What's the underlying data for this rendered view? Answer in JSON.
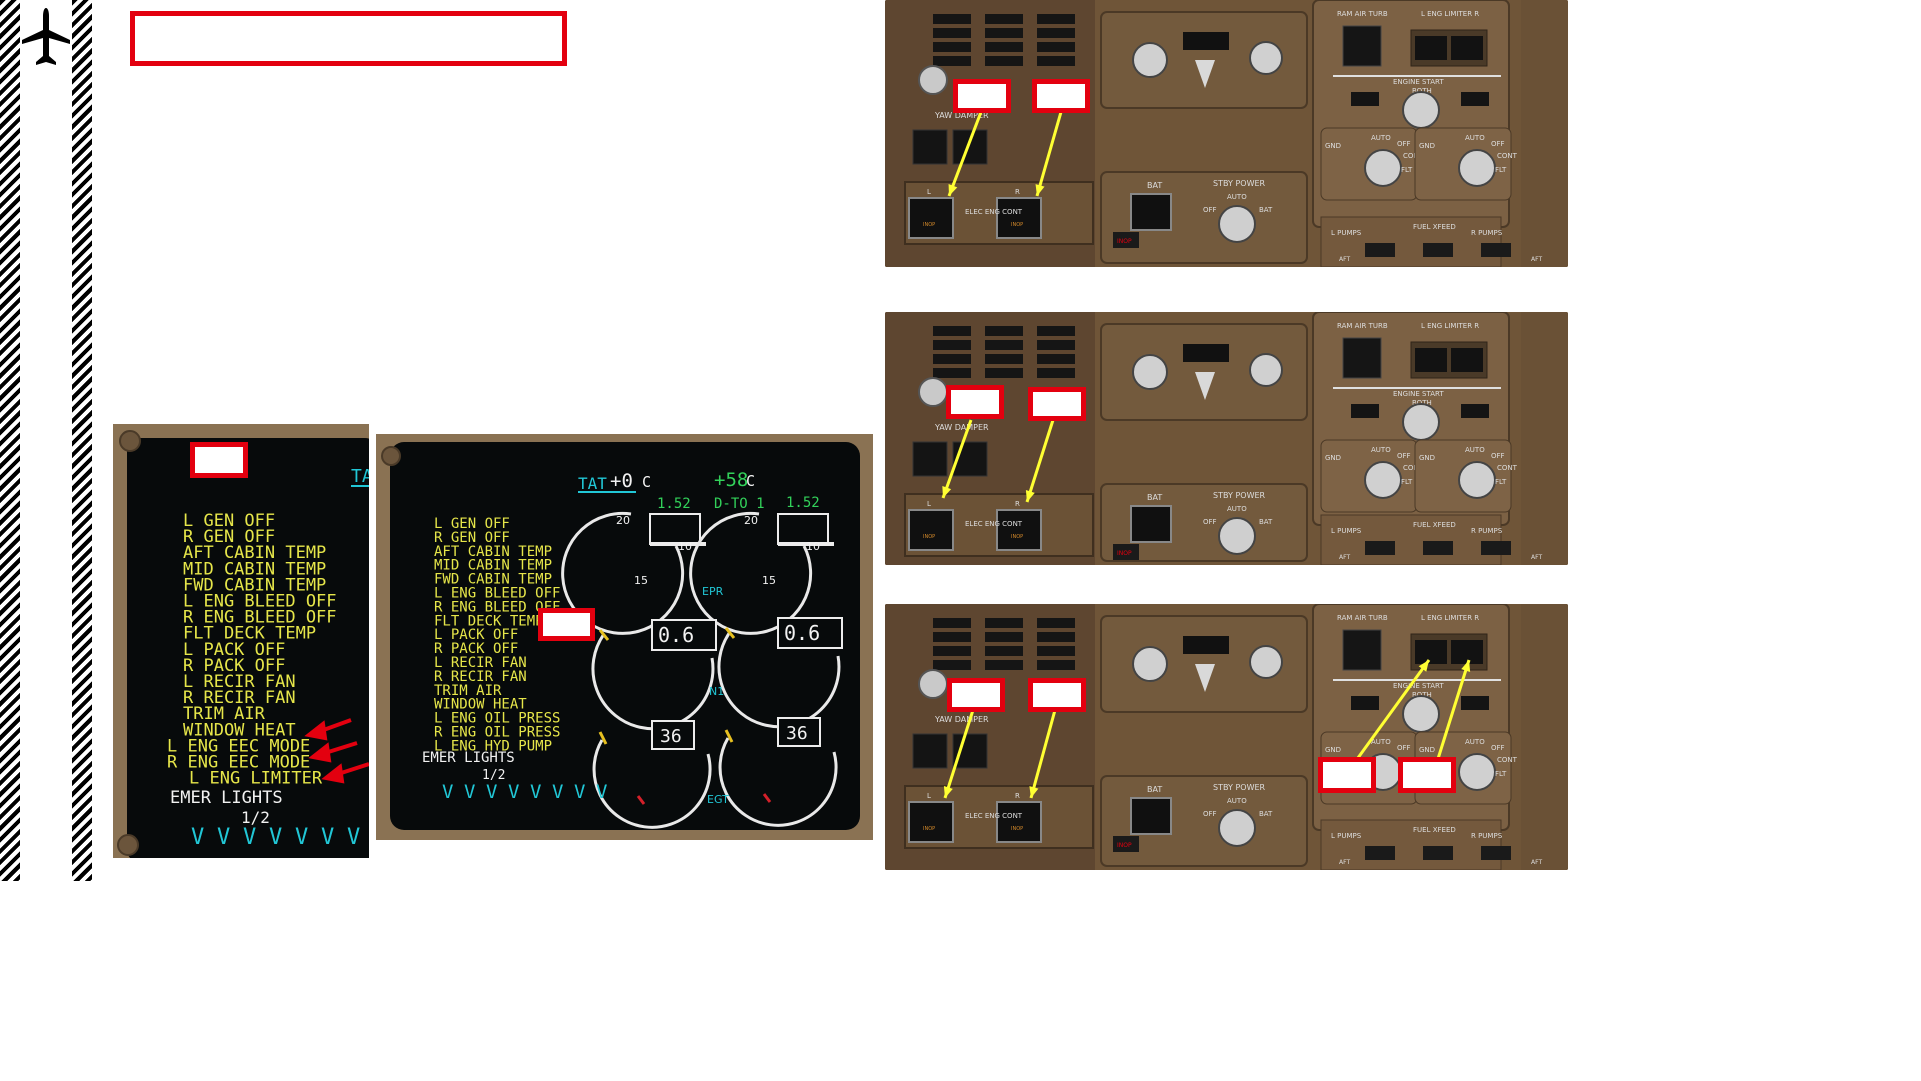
{
  "colors": {
    "accent_red": "#e3000f",
    "arrow_yellow": "#ffff33",
    "eicas_amber": "#e6e64a",
    "eicas_cyan": "#21c7d6",
    "eicas_green": "#32d15a",
    "panel_brown": "#7a5d40"
  },
  "sidebar": {
    "icon": "airplane-icon"
  },
  "title_box": {
    "text": ""
  },
  "eicas_left": {
    "label_box": "",
    "header_partial": "TA",
    "messages": [
      "L GEN OFF",
      "R GEN OFF",
      "AFT CABIN TEMP",
      "MID CABIN TEMP",
      "FWD CABIN TEMP",
      "L ENG BLEED OFF",
      "R ENG BLEED OFF",
      "FLT DECK TEMP",
      "L PACK OFF",
      "R PACK OFF",
      "L RECIR FAN",
      "R RECIR FAN",
      "TRIM AIR",
      "WINDOW HEAT",
      "L ENG EEC MODE",
      "R ENG EEC MODE",
      "L ENG LIMITER"
    ],
    "footer": "EMER LIGHTS",
    "page": "1/2"
  },
  "eicas_right": {
    "tat_label": "TAT",
    "tat_value": "+0",
    "tat_unit": "C",
    "assumed_temp": "+58",
    "assumed_unit": "C",
    "mode": "D-TO 1",
    "epr_left_target": "1.52",
    "epr_right_target": "1.52",
    "epr_label": "EPR",
    "n1_left": "0.6",
    "n1_right": "0.6",
    "n1_label": "N1",
    "egt_left": "36",
    "egt_right": "36",
    "egt_label": "EGT",
    "dial_tick_20": "20",
    "dial_tick_15": "15",
    "dial_tick_10": "10",
    "messages": [
      "L GEN OFF",
      "R GEN OFF",
      "AFT CABIN TEMP",
      "MID CABIN TEMP",
      "FWD CABIN TEMP",
      "L ENG BLEED OFF",
      "R ENG BLEED OFF",
      "FLT DECK TEMP",
      "L PACK OFF",
      "R PACK OFF",
      "L RECIR FAN",
      "R RECIR FAN",
      "TRIM AIR",
      "WINDOW HEAT",
      "L ENG OIL PRESS",
      "R ENG OIL PRESS",
      "L ENG HYD PUMP"
    ],
    "footer": "EMER LIGHTS",
    "page": "1/2"
  },
  "overhead": {
    "ram_air_turb": "RAM AIR TURB",
    "eng_limiter": "L ENG LIMITER R",
    "inop": "INOP",
    "engine_start": "ENGINE START",
    "both": "BOTH",
    "gnd": "GND",
    "auto": "AUTO",
    "off": "OFF",
    "cont": "CONT",
    "flt": "FLT",
    "bat": "BAT",
    "stby_power": "STBY POWER",
    "elec_eng_cont": "ELEC ENG CONT",
    "yaw_damper": "YAW DAMPER",
    "l": "L",
    "r": "R",
    "fuel_xfeed": "FUEL XFEED",
    "l_pumps": "L PUMPS",
    "r_pumps": "R PUMPS",
    "aft": "AFT"
  }
}
